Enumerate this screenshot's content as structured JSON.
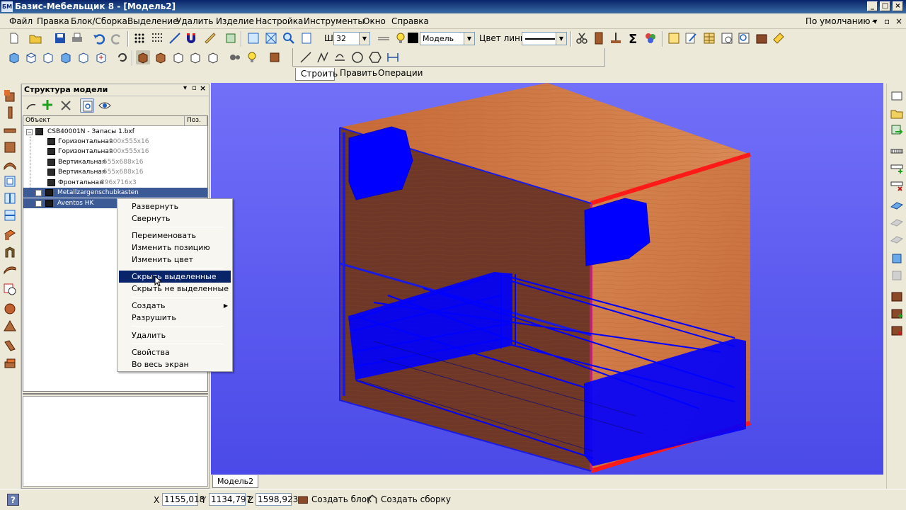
{
  "window": {
    "title": "Базис-Мебельщик 8 - [Модель2]",
    "logo": "БМ"
  },
  "menu": [
    "Файл",
    "Правка",
    "Блок/Сборка",
    "Выделение",
    "Удалить",
    "Изделие",
    "Настройка",
    "Инструменты",
    "Окно",
    "Справка"
  ],
  "preset": {
    "value": "По умолчанию",
    "arrow": "▾"
  },
  "toolbar": {
    "width_label": "Ш",
    "width_value": "32",
    "layer_value": "Модель",
    "line_color_label": "Цвет линии"
  },
  "drawtabs": [
    "Строить",
    "Править",
    "Операции"
  ],
  "panel": {
    "title": "Структура модели",
    "col_object": "Объект",
    "col_pos": "Поз.",
    "root": "CSB40001N - Запасы 1.bxf",
    "items": [
      {
        "name": "Горизонтальная",
        "dim": "900x555x16"
      },
      {
        "name": "Горизонтальная",
        "dim": "900x555x16"
      },
      {
        "name": "Вертикальная",
        "dim": "555x688x16"
      },
      {
        "name": "Вертикальная",
        "dim": "555x688x16"
      },
      {
        "name": "Фронтальная",
        "dim": "896x716x3"
      }
    ],
    "groups": [
      "Metallzargenschubkasten",
      "Aventos HK"
    ]
  },
  "context_menu": {
    "items": [
      "Развернуть",
      "Свернуть",
      "Переименовать",
      "Изменить позицию",
      "Изменить цвет",
      "Скрыть выделенные",
      "Скрыть не выделенные",
      "Создать",
      "Разрушить",
      "Удалить",
      "Свойства",
      "Во весь экран"
    ],
    "selected": "Скрыть выделенные"
  },
  "viewport_tab": "Модель2",
  "status": {
    "help": "?",
    "x_label": "X",
    "x_value": "1155,018",
    "y_label": "Y",
    "y_value": "1134,797",
    "z_label": "Z",
    "z_value": "1598,923",
    "create_block": "Создать блок",
    "create_assembly": "Создать сборку"
  },
  "colors": {
    "viewport_bg": "#5d5cf0",
    "wood": "#c96f3c",
    "edge_red": "#ff1a1a",
    "wire_blue": "#0000ff",
    "selection": "#0a246a"
  },
  "icons": [
    "new-file-icon",
    "open-folder-icon",
    "save-icon",
    "print-icon",
    "undo-icon",
    "redo-icon",
    "magnet-icon",
    "zoom-icon",
    "scissors-icon",
    "sum-icon",
    "line-icon",
    "circle-icon",
    "hexagon-icon",
    "dimension-icon",
    "question-icon"
  ]
}
